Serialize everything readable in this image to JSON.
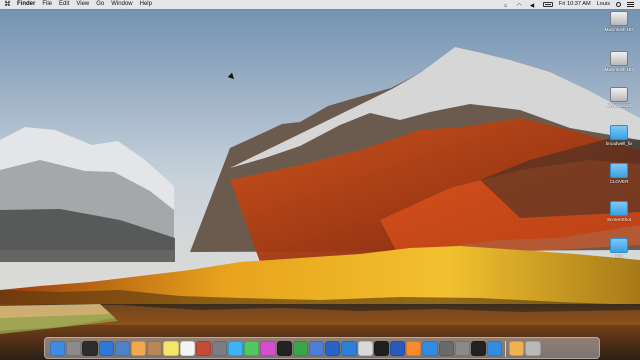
{
  "menubar": {
    "apple_label": "",
    "items": [
      {
        "label": "Finder"
      },
      {
        "label": "File"
      },
      {
        "label": "Edit"
      },
      {
        "label": "View"
      },
      {
        "label": "Go"
      },
      {
        "label": "Window"
      },
      {
        "label": "Help"
      }
    ],
    "status": {
      "time": "Fri 10:37 AM",
      "user": "Louis"
    }
  },
  "desktop": {
    "icons": [
      {
        "name": "macOS-disk",
        "label": "Macintosh HD",
        "type": "disk"
      },
      {
        "name": "disk-2",
        "label": "Macintosh HD",
        "type": "disk"
      },
      {
        "name": "windows-disk",
        "label": "Windows10",
        "type": "disk"
      },
      {
        "name": "folder-broadwell",
        "label": "broadwell_fix",
        "type": "folder"
      },
      {
        "name": "folder-clover",
        "label": "CLOVER",
        "type": "folder"
      },
      {
        "name": "folder-screenshots",
        "label": "ScreenShot",
        "type": "folder"
      },
      {
        "name": "folder-misc",
        "label": "kexts",
        "type": "folder"
      }
    ]
  },
  "dock": {
    "apps": [
      {
        "name": "finder",
        "color": "#3f8be6"
      },
      {
        "name": "launchpad",
        "color": "#8c8c8c"
      },
      {
        "name": "rocket",
        "color": "#2d2d2d"
      },
      {
        "name": "safari",
        "color": "#2a79d7"
      },
      {
        "name": "mail",
        "color": "#4f83c9"
      },
      {
        "name": "photos",
        "color": "#f1a94b"
      },
      {
        "name": "contacts",
        "color": "#b98757"
      },
      {
        "name": "notes",
        "color": "#f5e66a"
      },
      {
        "name": "calendar",
        "color": "#f4f4f4"
      },
      {
        "name": "photo-booth",
        "color": "#c64b37"
      },
      {
        "name": "system-preferences",
        "color": "#7b7d84"
      },
      {
        "name": "messages",
        "color": "#3bb3f6"
      },
      {
        "name": "facetime",
        "color": "#52c95f"
      },
      {
        "name": "itunes",
        "color": "#d54ed0"
      },
      {
        "name": "terminal",
        "color": "#222222"
      },
      {
        "name": "numbers",
        "color": "#38a64a"
      },
      {
        "name": "keynote",
        "color": "#4c7ed8"
      },
      {
        "name": "virtualbox",
        "color": "#2665c5"
      },
      {
        "name": "xcode",
        "color": "#2f7fd8"
      },
      {
        "name": "preview",
        "color": "#d9d9d9"
      },
      {
        "name": "activity-monitor",
        "color": "#1f1f1f"
      },
      {
        "name": "stocks",
        "color": "#2a59b8"
      },
      {
        "name": "ibooks",
        "color": "#ff8a2b"
      },
      {
        "name": "app-store",
        "color": "#2f8de6"
      },
      {
        "name": "vmware",
        "color": "#6a6a6a"
      },
      {
        "name": "disk-utility",
        "color": "#8a8a8a"
      },
      {
        "name": "quicktime",
        "color": "#222222"
      },
      {
        "name": "app-store-2",
        "color": "#2f8de6"
      },
      {
        "name": "photos-2",
        "color": "#f0b24c"
      },
      {
        "name": "trash",
        "color": "#b9b9b9"
      }
    ]
  }
}
